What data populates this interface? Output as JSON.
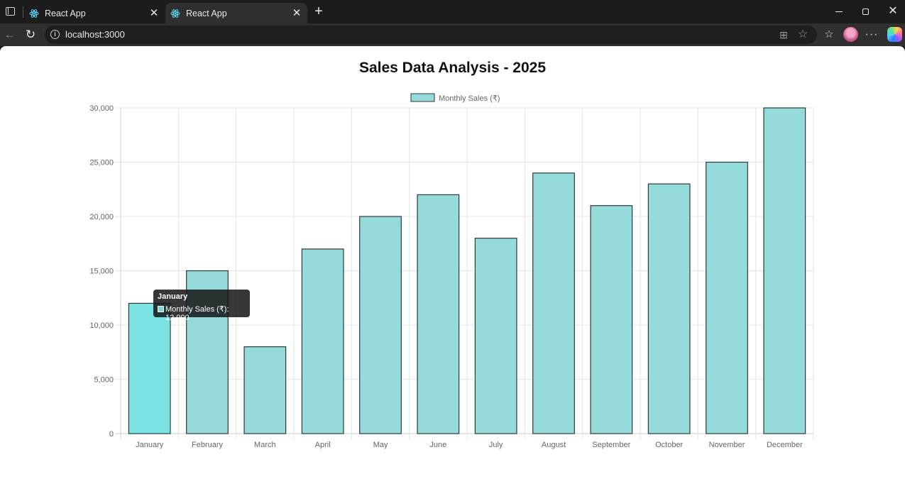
{
  "browser": {
    "tabs": [
      {
        "title": "React App",
        "close": "✕"
      },
      {
        "title": "React App",
        "close": "✕"
      }
    ],
    "new_tab": "+",
    "url": "localhost:3000",
    "window_controls": {
      "close": "✕"
    }
  },
  "page": {
    "title": "Sales Data Analysis - 2025"
  },
  "tooltip": {
    "title": "January",
    "label": "Monthly Sales (₹): 12,000"
  },
  "chart_data": {
    "type": "bar",
    "title": "Sales Data Analysis - 2025",
    "xlabel": "",
    "ylabel": "",
    "categories": [
      "January",
      "February",
      "March",
      "April",
      "May",
      "June",
      "July",
      "August",
      "September",
      "October",
      "November",
      "December"
    ],
    "series": [
      {
        "name": "Monthly Sales (₹)",
        "values": [
          12000,
          15000,
          8000,
          17000,
          20000,
          22000,
          18000,
          24000,
          21000,
          23000,
          25000,
          30000
        ]
      }
    ],
    "ylim": [
      0,
      30000
    ],
    "yticks": [
      "0",
      "5,000",
      "10,000",
      "15,000",
      "20,000",
      "25,000",
      "30,000"
    ],
    "grid": true,
    "legend": "top",
    "colors": {
      "bar": "#96dbdb",
      "bar_hover": "#7be3e3",
      "bar_border": "#2e3a3a"
    }
  }
}
